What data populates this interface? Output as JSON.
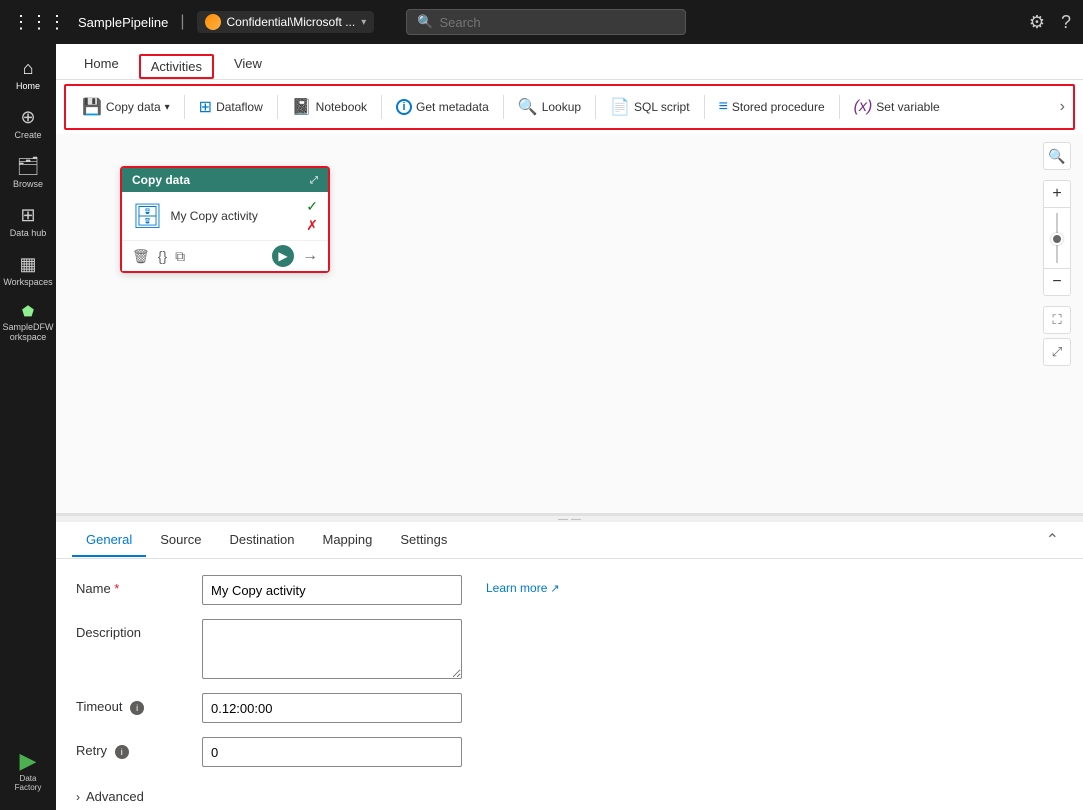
{
  "topbar": {
    "app_dots": "⋮⋮⋮",
    "title": "SamplePipeline",
    "separator": "|",
    "breadcrumb_text": "Confidential\\Microsoft ...",
    "search_placeholder": "Search",
    "settings_icon": "⚙",
    "help_icon": "?"
  },
  "sidebar": {
    "items": [
      {
        "id": "home",
        "icon": "⌂",
        "label": "Home"
      },
      {
        "id": "create",
        "icon": "+",
        "label": "Create"
      },
      {
        "id": "browse",
        "icon": "📁",
        "label": "Browse"
      },
      {
        "id": "datahub",
        "icon": "⊞",
        "label": "Data hub"
      },
      {
        "id": "workspaces",
        "icon": "▦",
        "label": "Workspaces"
      },
      {
        "id": "sampleDFW",
        "icon": "☁",
        "label": "SampleDFW orkspace"
      }
    ],
    "bottom": {
      "icon": "▶",
      "label": "Data Factory"
    }
  },
  "tabs": [
    {
      "id": "home",
      "label": "Home",
      "active": false
    },
    {
      "id": "activities",
      "label": "Activities",
      "active": true,
      "highlighted": true
    },
    {
      "id": "view",
      "label": "View",
      "active": false
    }
  ],
  "toolbar": {
    "buttons": [
      {
        "id": "copy-data",
        "icon": "💾",
        "label": "Copy data",
        "hasDropdown": true,
        "iconColor": "blue"
      },
      {
        "id": "dataflow",
        "icon": "⊞",
        "label": "Dataflow",
        "iconColor": "blue"
      },
      {
        "id": "notebook",
        "icon": "📓",
        "label": "Notebook",
        "iconColor": "blue"
      },
      {
        "id": "get-metadata",
        "icon": "ℹ",
        "label": "Get metadata",
        "iconColor": "blue"
      },
      {
        "id": "lookup",
        "icon": "🔍",
        "label": "Lookup",
        "iconColor": "orange"
      },
      {
        "id": "sql-script",
        "icon": "📄",
        "label": "SQL script",
        "iconColor": "blue"
      },
      {
        "id": "stored-procedure",
        "icon": "≡",
        "label": "Stored procedure",
        "iconColor": "blue"
      },
      {
        "id": "set-variable",
        "icon": "(x)",
        "label": "Set variable",
        "iconColor": "purple"
      }
    ],
    "more_icon": "›"
  },
  "canvas": {
    "node": {
      "header": "Copy data",
      "icon": "🗄",
      "label": "My Copy activity",
      "status_check": "✓",
      "status_x": "✗"
    }
  },
  "bottom_panel": {
    "tabs": [
      {
        "id": "general",
        "label": "General",
        "active": true
      },
      {
        "id": "source",
        "label": "Source",
        "active": false
      },
      {
        "id": "destination",
        "label": "Destination",
        "active": false
      },
      {
        "id": "mapping",
        "label": "Mapping",
        "active": false
      },
      {
        "id": "settings",
        "label": "Settings",
        "active": false
      }
    ],
    "form": {
      "name_label": "Name",
      "name_value": "My Copy activity",
      "name_required": true,
      "learn_more_text": "Learn more",
      "learn_more_icon": "↗",
      "description_label": "Description",
      "description_value": "",
      "timeout_label": "Timeout",
      "timeout_value": "0.12:00:00",
      "retry_label": "Retry",
      "retry_value": "0",
      "advanced_label": "Advanced"
    }
  }
}
